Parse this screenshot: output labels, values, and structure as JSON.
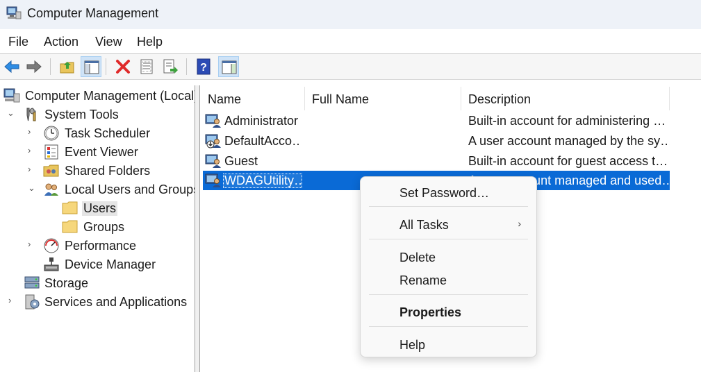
{
  "window": {
    "title": "Computer Management"
  },
  "menubar": {
    "items": [
      "File",
      "Action",
      "View",
      "Help"
    ]
  },
  "toolbar": {
    "icons": [
      "back-arrow-icon",
      "forward-arrow-icon",
      "up-folder-icon",
      "show-hide-tree-icon",
      "delete-icon",
      "properties-icon",
      "export-list-icon",
      "help-icon",
      "show-hide-action-pane-icon"
    ]
  },
  "tree": {
    "nodes": [
      {
        "label": "Computer Management (Local)"
      },
      {
        "label": "System Tools"
      },
      {
        "label": "Task Scheduler"
      },
      {
        "label": "Event Viewer"
      },
      {
        "label": "Shared Folders"
      },
      {
        "label": "Local Users and Groups"
      },
      {
        "label": "Users"
      },
      {
        "label": "Groups"
      },
      {
        "label": "Performance"
      },
      {
        "label": "Device Manager"
      },
      {
        "label": "Storage"
      },
      {
        "label": "Services and Applications"
      }
    ],
    "selected": "Users"
  },
  "list": {
    "columns": [
      "Name",
      "Full Name",
      "Description"
    ],
    "rows": [
      {
        "name": "Administrator",
        "full_name": "",
        "description": "Built-in account for administering …"
      },
      {
        "name": "DefaultAcco…",
        "full_name": "",
        "description": "A user account managed by the sy…"
      },
      {
        "name": "Guest",
        "full_name": "",
        "description": "Built-in account for guest access t…"
      },
      {
        "name": "WDAGUtility…",
        "full_name": "",
        "description": "A user account managed and used…"
      }
    ],
    "selected_row": "WDAGUtility…"
  },
  "context_menu": {
    "set_password": "Set Password…",
    "all_tasks": "All Tasks",
    "all_tasks_arrow": "›",
    "delete": "Delete",
    "rename": "Rename",
    "properties": "Properties",
    "help": "Help"
  },
  "colors": {
    "selection": "#0a6ad6",
    "titlebar": "#eef2f8"
  }
}
